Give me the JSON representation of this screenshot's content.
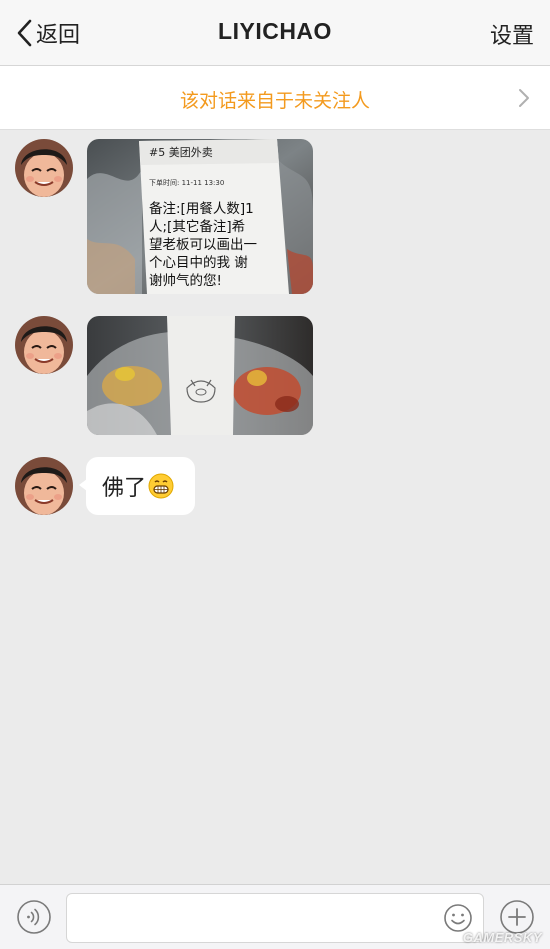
{
  "nav": {
    "back_label": "返回",
    "title": "LIYICHAO",
    "settings_label": "设置"
  },
  "notice": {
    "text": "该对话来自于未关注人"
  },
  "messages": [
    {
      "type": "image",
      "description_icon": "receipt-photo"
    },
    {
      "type": "image",
      "description_icon": "food-bag-photo"
    },
    {
      "type": "text",
      "text": "佛了",
      "emoji": "grin-emoji"
    }
  ],
  "photo1": {
    "receipt_header": "#5 美团外卖",
    "receipt_time": "下单时间: 11-11 13:30",
    "receipt_note_lines": [
      "备注:[用餐人数]1",
      "人;[其它备注]希",
      "望老板可以画出一",
      "个心目中的我  谢",
      "谢帅气的您!"
    ]
  },
  "input": {
    "value": "",
    "placeholder": ""
  },
  "watermark": "GAMERSKY",
  "colors": {
    "notice_text": "#f39a1e",
    "background": "#ebebeb",
    "navbar": "#f7f7f7"
  }
}
